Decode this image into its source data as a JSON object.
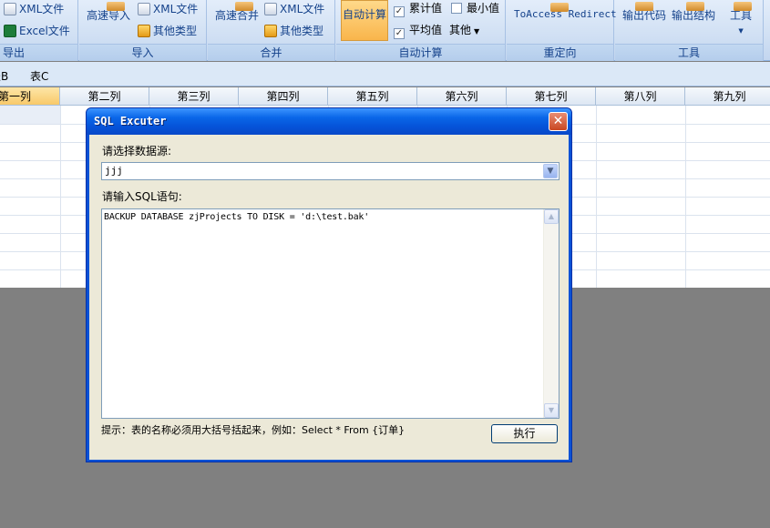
{
  "ribbon": {
    "export_group": {
      "label": "导出",
      "xml_file": "XML文件",
      "excel_file": "Excel文件"
    },
    "import_group": {
      "label": "导入",
      "fast_import": "高速导入",
      "xml_file": "XML文件",
      "other_types": "其他类型"
    },
    "merge_group": {
      "label": "合并",
      "fast_merge": "高速合并",
      "xml_file": "XML文件",
      "other_types": "其他类型"
    },
    "autocalc_group": {
      "label": "自动计算",
      "auto_calc": "自动计算",
      "cumulative": "累计值",
      "cumulative_checked": true,
      "min": "最小值",
      "min_checked": false,
      "average": "平均值",
      "average_checked": true,
      "other": "其他"
    },
    "redirect_group": {
      "label": "重定向",
      "to_access": "ToAccess Redirect"
    },
    "tools_group": {
      "label": "工具",
      "output_code": "输出代码",
      "output_structure": "输出结构",
      "tools": "工具"
    }
  },
  "sheet_tabs": [
    "表B",
    "表C"
  ],
  "grid": {
    "columns": [
      "第一列",
      "第二列",
      "第三列",
      "第四列",
      "第五列",
      "第六列",
      "第七列",
      "第八列",
      "第九列"
    ]
  },
  "dialog": {
    "title": "SQL Excuter",
    "datasource_label": "请选择数据源:",
    "datasource_value": "jjj",
    "sql_label": "请输入SQL语句:",
    "sql_text": "BACKUP DATABASE zjProjects TO DISK = 'd:\\test.bak'",
    "hint": "提示：表的名称必须用大括号括起来，例如：Select * From {订单}",
    "execute_button": "执行"
  }
}
